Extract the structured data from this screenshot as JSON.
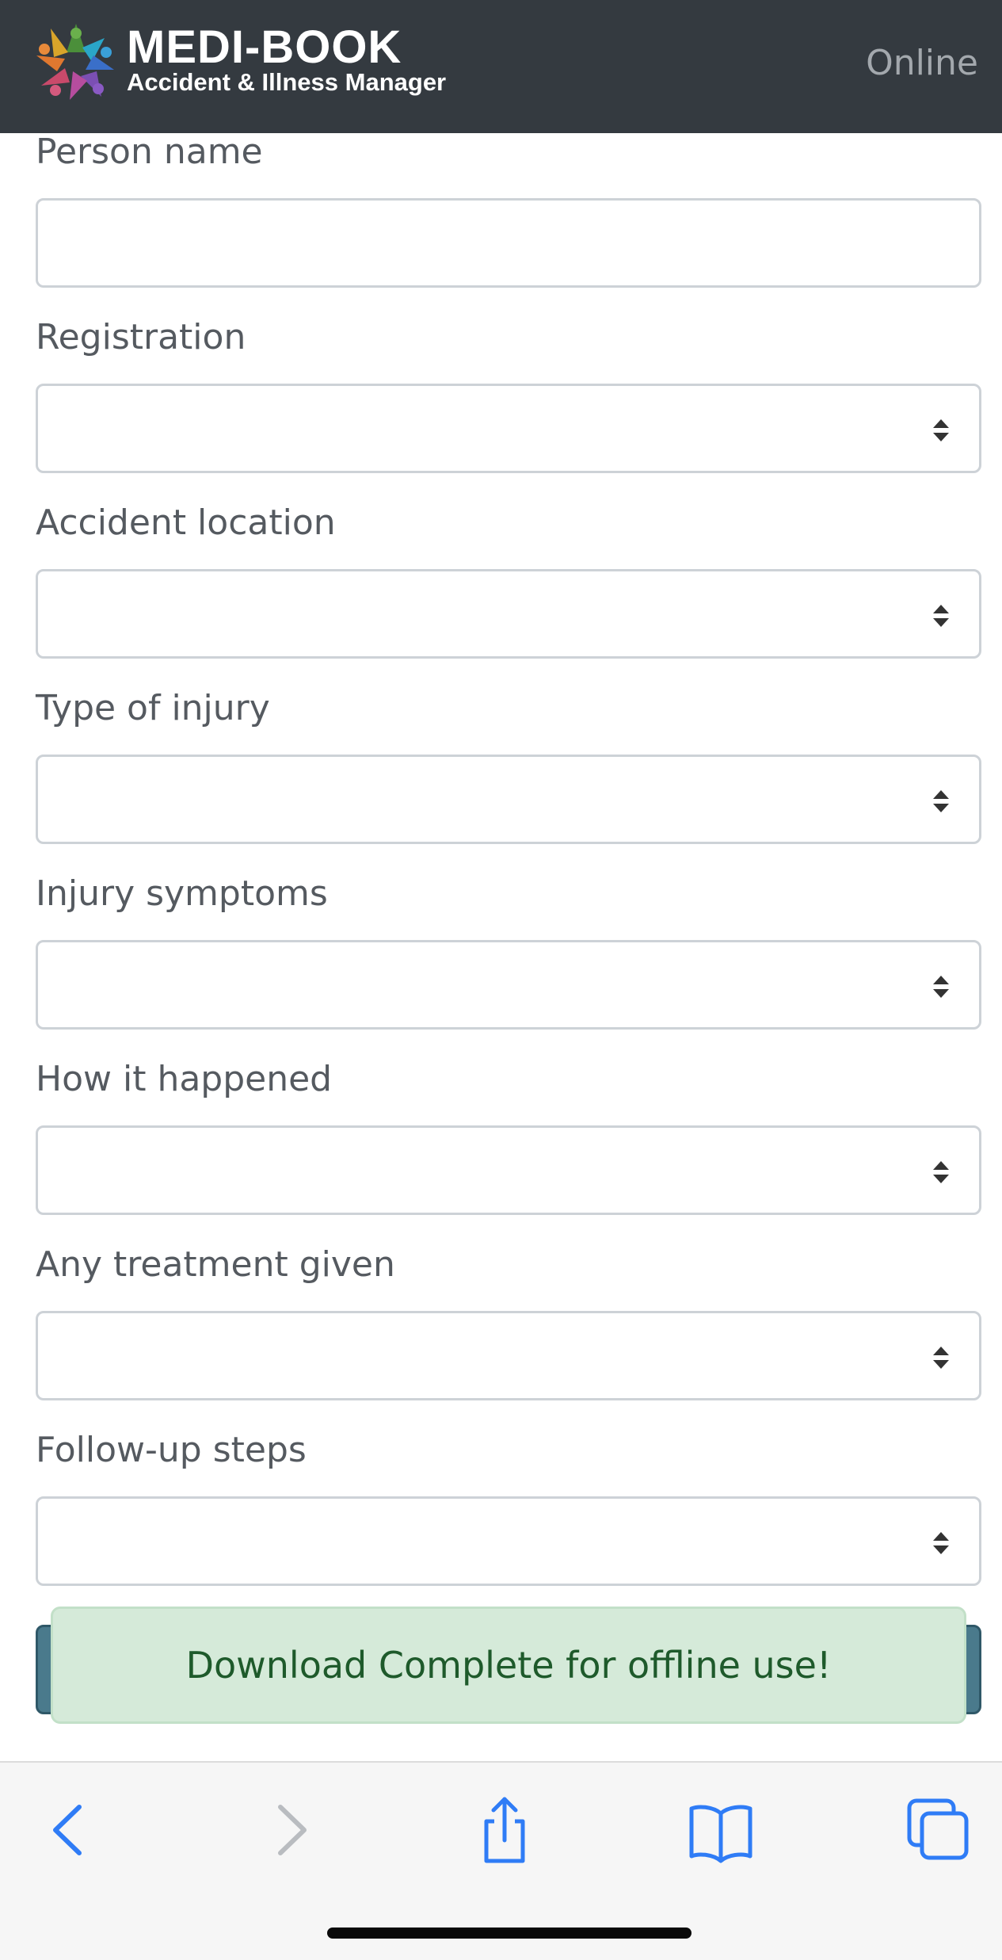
{
  "header": {
    "title": "MEDI-BOOK",
    "subtitle": "Accident & Illness Manager",
    "status": "Online",
    "logo_icon": "colorful-star-logo-icon",
    "background_color": "#343a40"
  },
  "form": {
    "fields": [
      {
        "label": "Person name",
        "type": "text",
        "value": ""
      },
      {
        "label": "Registration",
        "type": "select",
        "value": ""
      },
      {
        "label": "Accident location",
        "type": "select",
        "value": ""
      },
      {
        "label": "Type of injury",
        "type": "select",
        "value": ""
      },
      {
        "label": "Injury symptoms",
        "type": "select",
        "value": ""
      },
      {
        "label": "How it happened",
        "type": "select",
        "value": ""
      },
      {
        "label": "Any treatment given",
        "type": "select",
        "value": ""
      },
      {
        "label": "Follow-up steps",
        "type": "select",
        "value": ""
      }
    ],
    "submit_color": "#4a7a8c"
  },
  "toast": {
    "message": "Download Complete for offline use!",
    "background_color": "#d5ead9",
    "text_color": "#1e5a2b"
  },
  "browser_toolbar": {
    "icons": [
      "back-icon",
      "forward-icon",
      "share-icon",
      "bookmarks-icon",
      "tabs-icon"
    ],
    "accent_color": "#2f7cf6"
  }
}
